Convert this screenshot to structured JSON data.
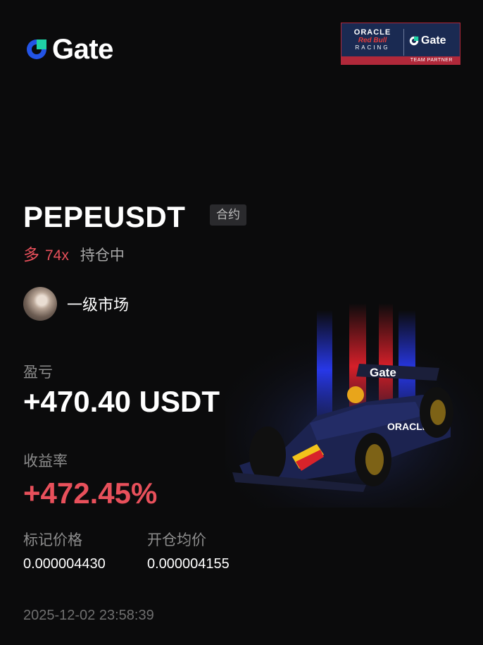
{
  "brand": {
    "name": "Gate",
    "icon": "gate-logo-icon",
    "accent": "#2354e6"
  },
  "partner_badge": {
    "oracle": "ORACLE",
    "redbull": "Red Bull",
    "racing": "RACING",
    "gate": "Gate",
    "footer": "TEAM PARTNER"
  },
  "position": {
    "pair": "PEPEUSDT",
    "type_tag": "合约",
    "side": "多",
    "leverage": "74x",
    "status": "持仓中"
  },
  "user": {
    "name": "一级市场"
  },
  "pnl": {
    "label": "盈亏",
    "value": "+470.40 USDT"
  },
  "roi": {
    "label": "收益率",
    "value": "+472.45%"
  },
  "prices": {
    "mark_label": "标记价格",
    "mark_value": "0.000004430",
    "entry_label": "开仓均价",
    "entry_value": "0.000004155"
  },
  "timestamp": "2025-12-02 23:58:39",
  "colors": {
    "positive": "#e8505b",
    "background": "#0b0b0c",
    "muted": "#8d8d8d"
  },
  "car": {
    "livery_text": "Gate",
    "sponsor": "ORACLE"
  }
}
